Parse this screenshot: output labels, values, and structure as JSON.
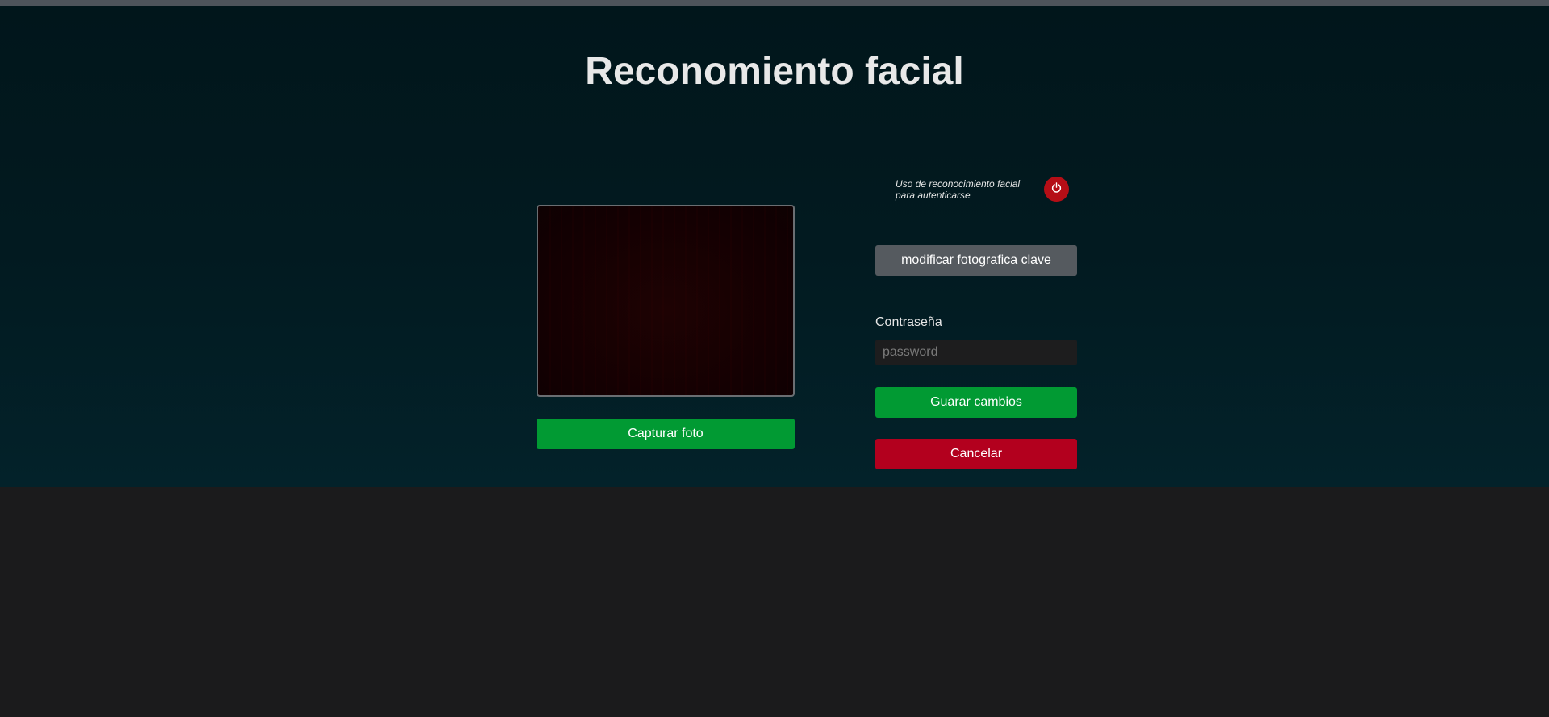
{
  "page": {
    "title": "Reconomiento facial"
  },
  "camera": {
    "capture_label": "Capturar foto"
  },
  "face_auth": {
    "toggle_label": "Uso de reconocimiento facial para autenticarse",
    "toggle_icon": "power-icon",
    "toggle_color": "#b50e16"
  },
  "actions": {
    "modify_label": "modificar fotografica clave",
    "save_label": "Guarar cambios",
    "cancel_label": "Cancelar"
  },
  "password": {
    "label": "Contraseña",
    "placeholder": "password",
    "value": ""
  },
  "colors": {
    "success": "#019a33",
    "danger": "#b3001e",
    "secondary": "#555a5f",
    "panel_bg": "#021a20"
  }
}
